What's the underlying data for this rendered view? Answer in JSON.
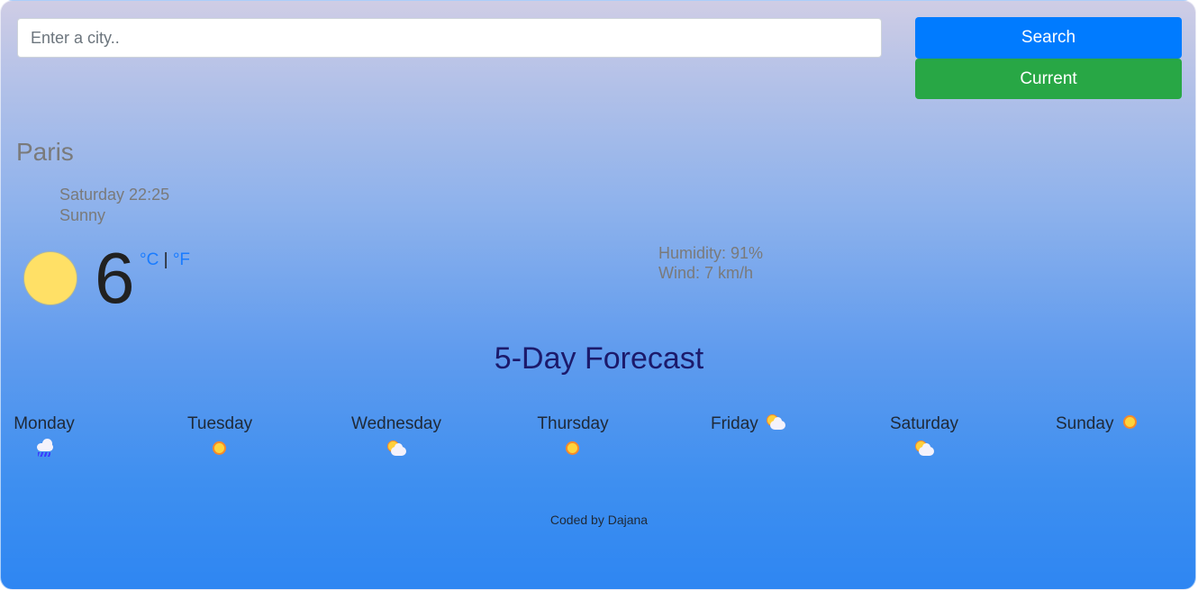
{
  "search": {
    "placeholder": "Enter a city..",
    "value": "",
    "search_label": "Search",
    "current_label": "Current"
  },
  "current": {
    "city": "Paris",
    "datetime": "Saturday 22:25",
    "description": "Sunny",
    "icon": "sun-icon",
    "temperature": "6",
    "unit_celsius": "°C",
    "unit_separator": "|",
    "unit_fahrenheit": "°F",
    "humidity": "Humidity: 91%",
    "wind": "Wind: 7 km/h"
  },
  "forecast": {
    "title": "5-Day Forecast",
    "days": [
      {
        "name": "Monday",
        "icon": "rain-icon"
      },
      {
        "name": "Tuesday",
        "icon": "sun-icon"
      },
      {
        "name": "Wednesday",
        "icon": "partly-cloudy-icon"
      },
      {
        "name": "Thursday",
        "icon": "sun-icon"
      },
      {
        "name": "Friday",
        "icon": "partly-cloudy-icon"
      },
      {
        "name": "Saturday",
        "icon": "partly-cloudy-icon"
      },
      {
        "name": "Sunday",
        "icon": "sun-icon"
      }
    ]
  },
  "footer": {
    "text": "Coded by Dajana"
  },
  "colors": {
    "search_button": "#007bff",
    "current_button": "#28a745",
    "unit_link": "#1a7cff",
    "forecast_title": "#1c1a6b"
  }
}
